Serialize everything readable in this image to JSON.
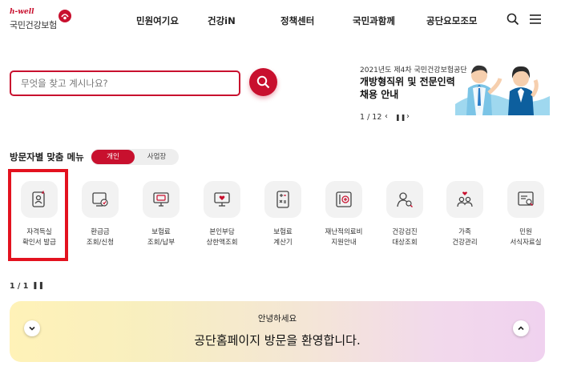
{
  "header": {
    "logo_sub": "h-well",
    "logo_main": "국민건강보험",
    "nav": [
      "민원여기요",
      "건강iN",
      "정책센터",
      "국민과함께",
      "공단요모조모"
    ],
    "icons": [
      "search-icon",
      "menu-icon"
    ]
  },
  "search": {
    "placeholder": "무엇을 찾고 계시나요?"
  },
  "banner": {
    "small": "2021년도 제4차 국민건강보험공단",
    "title_line1": "개방형직위 및 전문인력",
    "title_line2": "채용 안내",
    "pager": "1 / 12"
  },
  "menu": {
    "title": "방문자별 맞춤 메뉴",
    "toggle_personal": "개인",
    "toggle_business": "사업장",
    "items": [
      {
        "label": "자격득실\n확인서 발급",
        "icon": "certificate-icon"
      },
      {
        "label": "환급금\n조회/신청",
        "icon": "refund-icon"
      },
      {
        "label": "보험료\n조회/납부",
        "icon": "premium-payment-icon"
      },
      {
        "label": "본인부담\n상한액조회",
        "icon": "copay-limit-icon"
      },
      {
        "label": "보험료\n계산기",
        "icon": "calculator-icon"
      },
      {
        "label": "재난적의료비\n지원안내",
        "icon": "medical-support-icon"
      },
      {
        "label": "건강검진\n대상조회",
        "icon": "checkup-icon"
      },
      {
        "label": "가족\n건강관리",
        "icon": "family-icon"
      },
      {
        "label": "민원\n서식자료실",
        "icon": "forms-icon"
      }
    ],
    "pager": "1 / 1"
  },
  "welcome": {
    "small": "안녕하세요",
    "large": "공단홈페이지 방문을 환영합니다."
  },
  "colors": {
    "brand": "#c8102e",
    "highlight": "#e3121f"
  }
}
